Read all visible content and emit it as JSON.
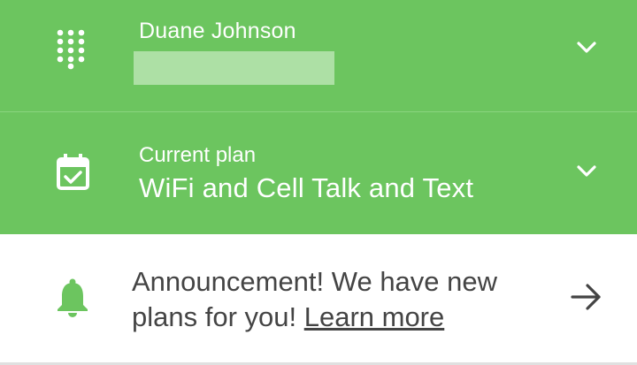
{
  "account": {
    "name": "Duane Johnson",
    "phone_icon": "dialpad-icon",
    "expand_icon": "chevron-down-icon"
  },
  "plan": {
    "caption": "Current plan",
    "name": "WiFi and Cell Talk and Text",
    "icon": "calendar-check-icon",
    "expand_icon": "chevron-down-icon"
  },
  "announcement": {
    "text": "Announcement! We have new plans for you! ",
    "link_label": "Learn more",
    "icon": "bell-icon",
    "action_icon": "arrow-right-icon"
  },
  "colors": {
    "header_green": "#6cc55f",
    "text_dark": "#444444",
    "bell_green": "#6cc55f"
  }
}
